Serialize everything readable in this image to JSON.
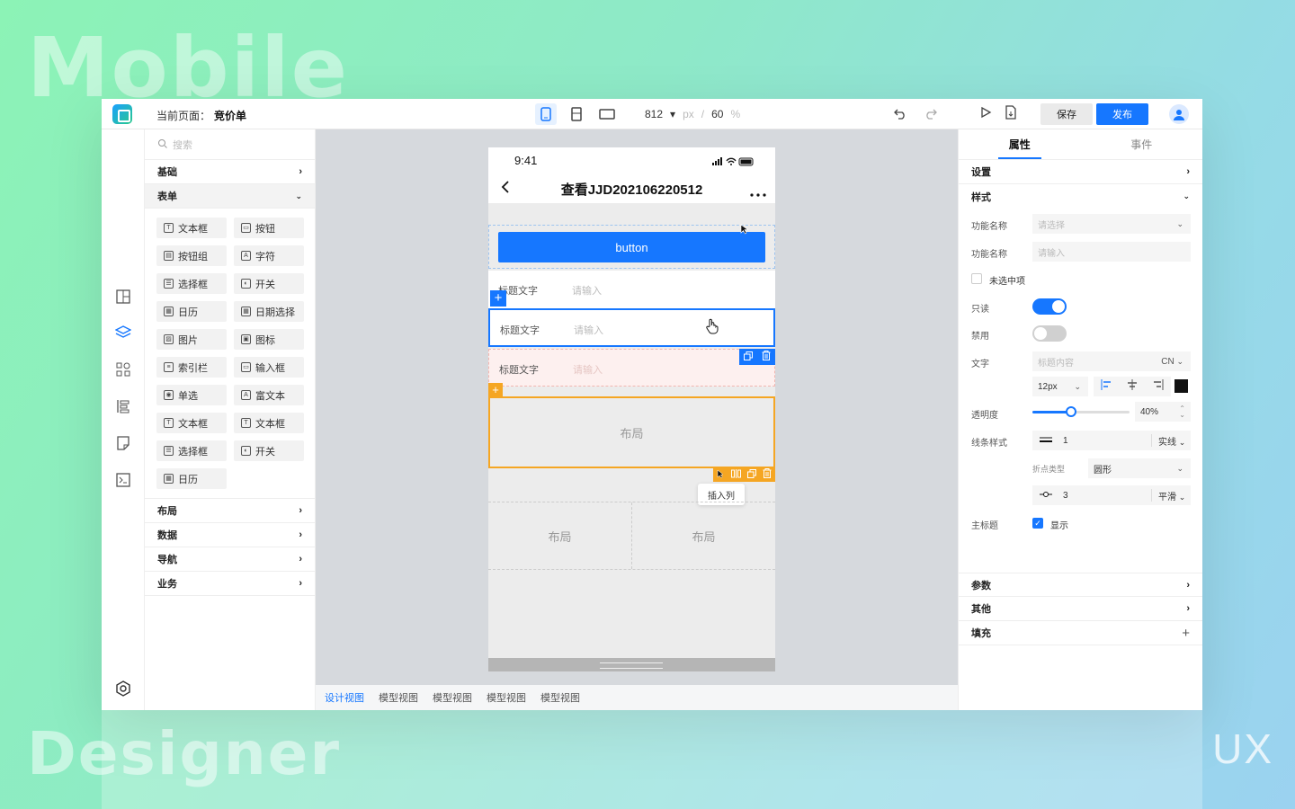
{
  "deco": {
    "mobile": "Mobile",
    "designer": "Designer",
    "ux": "UX"
  },
  "topbar": {
    "page_label": "当前页面：",
    "page_name": "竞价单",
    "width": "812",
    "width_unit": "px",
    "sep": "/",
    "zoom": "60",
    "zoom_unit": "%",
    "save": "保存",
    "publish": "发布"
  },
  "panel": {
    "search_placeholder": "搜索",
    "sections": {
      "basic": "基础",
      "form": "表单",
      "layout": "布局",
      "data": "数据",
      "nav": "导航",
      "biz": "业务"
    },
    "items": [
      {
        "label": "文本框",
        "glyph": "T"
      },
      {
        "label": "按钮",
        "glyph": "▭"
      },
      {
        "label": "按钮组",
        "glyph": "▤"
      },
      {
        "label": "字符",
        "glyph": "A"
      },
      {
        "label": "选择框",
        "glyph": "☰"
      },
      {
        "label": "开关",
        "glyph": "◐"
      },
      {
        "label": "日历",
        "glyph": "▦"
      },
      {
        "label": "日期选择",
        "glyph": "▦"
      },
      {
        "label": "图片",
        "glyph": "▨"
      },
      {
        "label": "图标",
        "glyph": "▣"
      },
      {
        "label": "索引栏",
        "glyph": "≡"
      },
      {
        "label": "输入框",
        "glyph": "▭"
      },
      {
        "label": "单选",
        "glyph": "◉"
      },
      {
        "label": "富文本",
        "glyph": "A"
      },
      {
        "label": "文本框",
        "glyph": "T"
      },
      {
        "label": "文本框",
        "glyph": "T"
      },
      {
        "label": "选择框",
        "glyph": "☰"
      },
      {
        "label": "开关",
        "glyph": "◐"
      },
      {
        "label": "日历",
        "glyph": "▦"
      }
    ]
  },
  "phone": {
    "time": "9:41",
    "title": "查看JJD202106220512",
    "button": "button",
    "row_label": "标题文字",
    "row_placeholder": "请输入",
    "layout": "布局",
    "insert_col": "插入列"
  },
  "view_tabs": [
    "设计视图",
    "模型视图",
    "模型视图",
    "模型视图",
    "模型视图"
  ],
  "right": {
    "tab_props": "属性",
    "tab_events": "事件",
    "settings": "设置",
    "style": "样式",
    "params": "参数",
    "other": "其他",
    "fill": "填充",
    "fn_name": "功能名称",
    "select_ph": "请选择",
    "input_ph": "请输入",
    "unchecked": "未选中项",
    "readonly": "只读",
    "disabled": "禁用",
    "text": "文字",
    "text_ph": "标题内容",
    "lang": "CN",
    "font_size": "12px",
    "opacity": "透明度",
    "opacity_val": "40%",
    "opacity_level": 0.4,
    "line_style": "线条样式",
    "line_width": "1",
    "line_type": "实线",
    "point_type": "折点类型",
    "point_shape": "圆形",
    "point_size": "3",
    "smooth": "平滑",
    "main_title": "主标题",
    "show": "显示"
  },
  "colors": {
    "accent": "#1677ff",
    "select_outline": "#f5a623"
  }
}
